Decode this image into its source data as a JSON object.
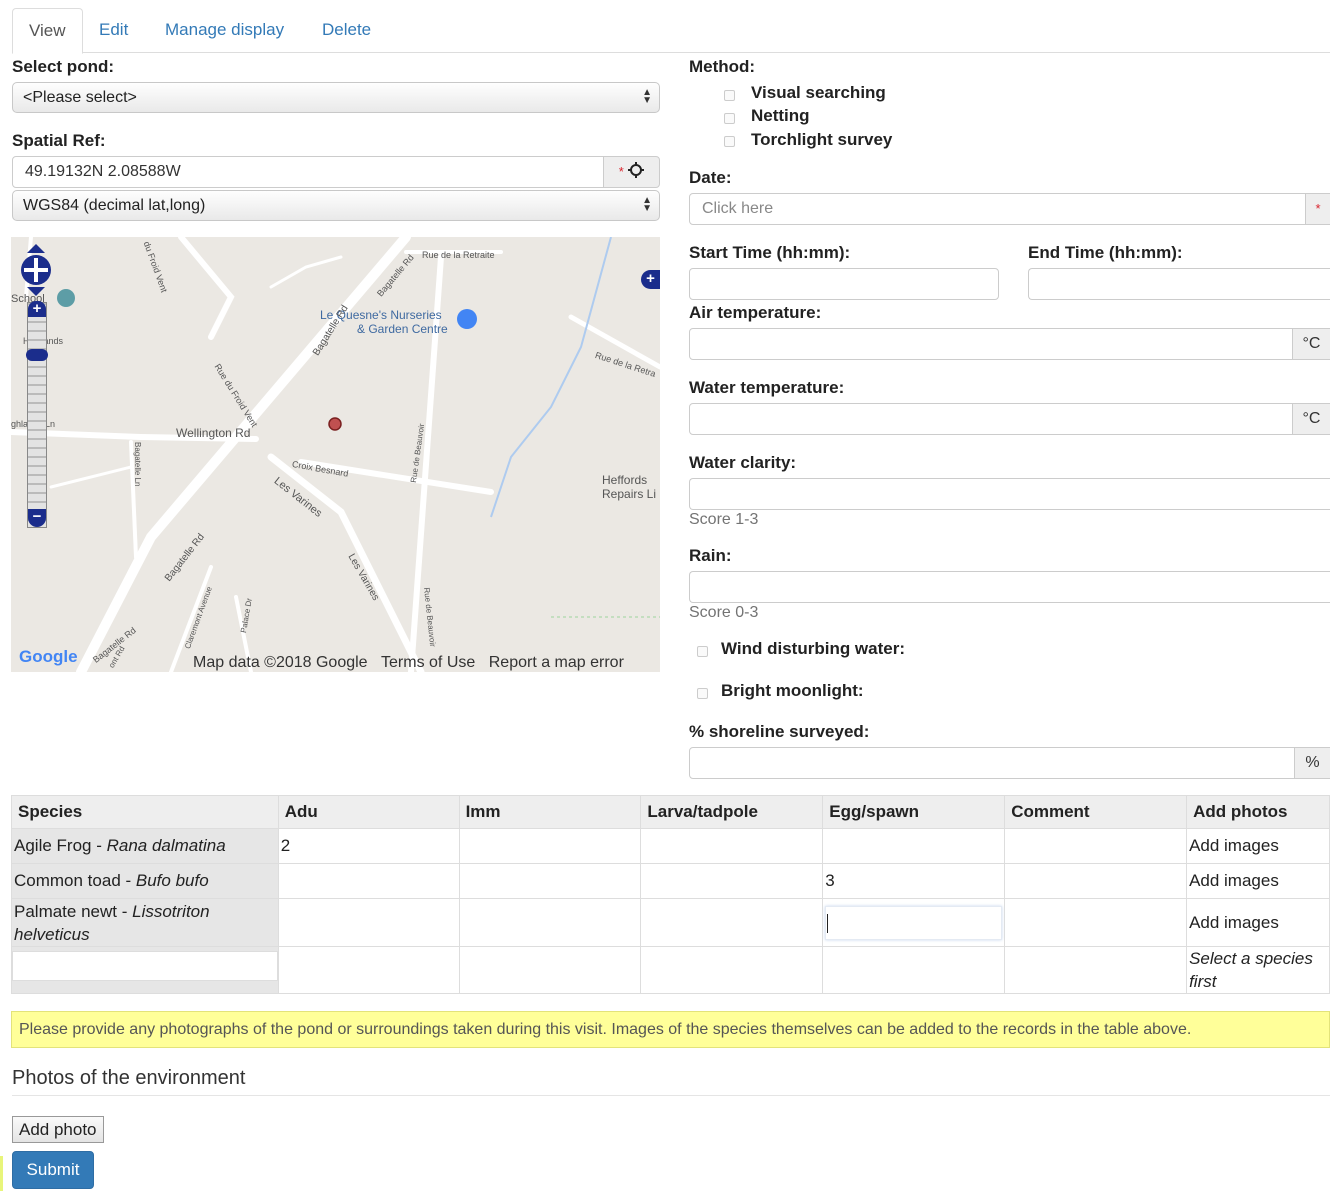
{
  "tabs": [
    "View",
    "Edit",
    "Manage display",
    "Delete"
  ],
  "pond": {
    "label": "Select pond:",
    "value": "<Please select>"
  },
  "spatial": {
    "label": "Spatial Ref:",
    "value": "49.19132N 2.08588W",
    "required": "*",
    "system": "WGS84 (decimal lat,long)"
  },
  "map": {
    "labels": {
      "school": "School",
      "retraite": "Rue de la Retraite",
      "retraite2": "Rue de la Retra",
      "nurseries1": "Le Quesne's Nurseries",
      "nurseries2": "& Garden Centre",
      "bagatelle_rd": "Bagatelle Rd",
      "bagatelle_rd2": "Bagatelle Rd",
      "bagatelle_rd3": "Bagatelle Rd",
      "bagatelle_top": "Bagatelle Rd",
      "froid_vent": "Rue du Froid Vent",
      "froid_vent_top": "du Froid Vent",
      "highlands": "Highlands",
      "wellington": "Wellington Rd",
      "highlands_ln": "ghlands Ln",
      "croix": "Croix Besnard",
      "varines": "Les Varines",
      "varines2": "Les Varines",
      "beauvoir": "Rue de Beauvoir",
      "beauvoir2": "Rue de Beauvoir",
      "heffords1": "Heffords",
      "heffords2": "Repairs Li",
      "bagatelle_ln": "Bagatelle Ln",
      "claremont": "Claremont Avenue",
      "palace": "Palace Dr",
      "mont_rd": "ont Rd"
    },
    "google": "Google",
    "attribution": "Map data ©2018 Google",
    "terms": "Terms of Use",
    "report": "Report a map error"
  },
  "method": {
    "label": "Method:",
    "options": [
      "Visual searching",
      "Netting",
      "Torchlight survey"
    ]
  },
  "date": {
    "label": "Date:",
    "placeholder": "Click here",
    "required": "*"
  },
  "start_time": {
    "label": "Start Time (hh:mm):"
  },
  "end_time": {
    "label": "End Time (hh:mm):"
  },
  "air_temp": {
    "label": "Air temperature:",
    "unit": "°C"
  },
  "water_temp": {
    "label": "Water temperature:",
    "unit": "°C"
  },
  "water_clarity": {
    "label": "Water clarity:",
    "help": "Score 1-3"
  },
  "rain": {
    "label": "Rain:",
    "help": "Score 0-3"
  },
  "wind": {
    "label": "Wind disturbing water:"
  },
  "moonlight": {
    "label": "Bright moonlight:"
  },
  "shoreline": {
    "label": "% shoreline surveyed:",
    "unit": "%"
  },
  "species_table": {
    "headers": [
      "Species",
      "Adu",
      "Imm",
      "Larva/tadpole",
      "Egg/spawn",
      "Comment",
      "Add photos"
    ],
    "rows": [
      {
        "common": "Agile Frog - ",
        "latin": "Rana dalmatina",
        "adu": "2",
        "egg": "",
        "photos": "Add images"
      },
      {
        "common": "Common toad - ",
        "latin": "Bufo bufo",
        "adu": "",
        "egg": "3",
        "photos": "Add images"
      },
      {
        "common": "Palmate newt - ",
        "latin": "Lissotriton helveticus",
        "adu": "",
        "egg": "",
        "photos": "Add images"
      }
    ],
    "empty_photos": "Select a species first"
  },
  "notice": "Please provide any photographs of the pond or surroundings taken during this visit. Images of the species themselves can be added to the records in the table above.",
  "env_heading": "Photos of the environment",
  "add_photo": "Add photo",
  "submit": "Submit"
}
